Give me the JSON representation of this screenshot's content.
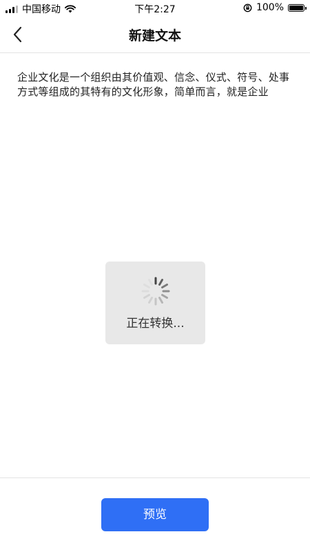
{
  "status_bar": {
    "carrier": "中国移动",
    "time": "下午2:27",
    "battery_percent": "100%",
    "icons": [
      "signal-icon",
      "wifi-icon",
      "orientation-lock-icon",
      "battery-icon"
    ]
  },
  "nav": {
    "title": "新建文本",
    "back_icon": "chevron-left-icon"
  },
  "content": {
    "text": "企业文化是一个组织由其价值观、信念、仪式、符号、处事方式等组成的其特有的文化形象，简单而言，就是企业"
  },
  "loading": {
    "text": "正在转换..."
  },
  "footer": {
    "preview_label": "预览"
  },
  "colors": {
    "accent": "#2f6ff5",
    "loading_bg": "#e8e8e8",
    "divider": "#e2e2e2"
  }
}
